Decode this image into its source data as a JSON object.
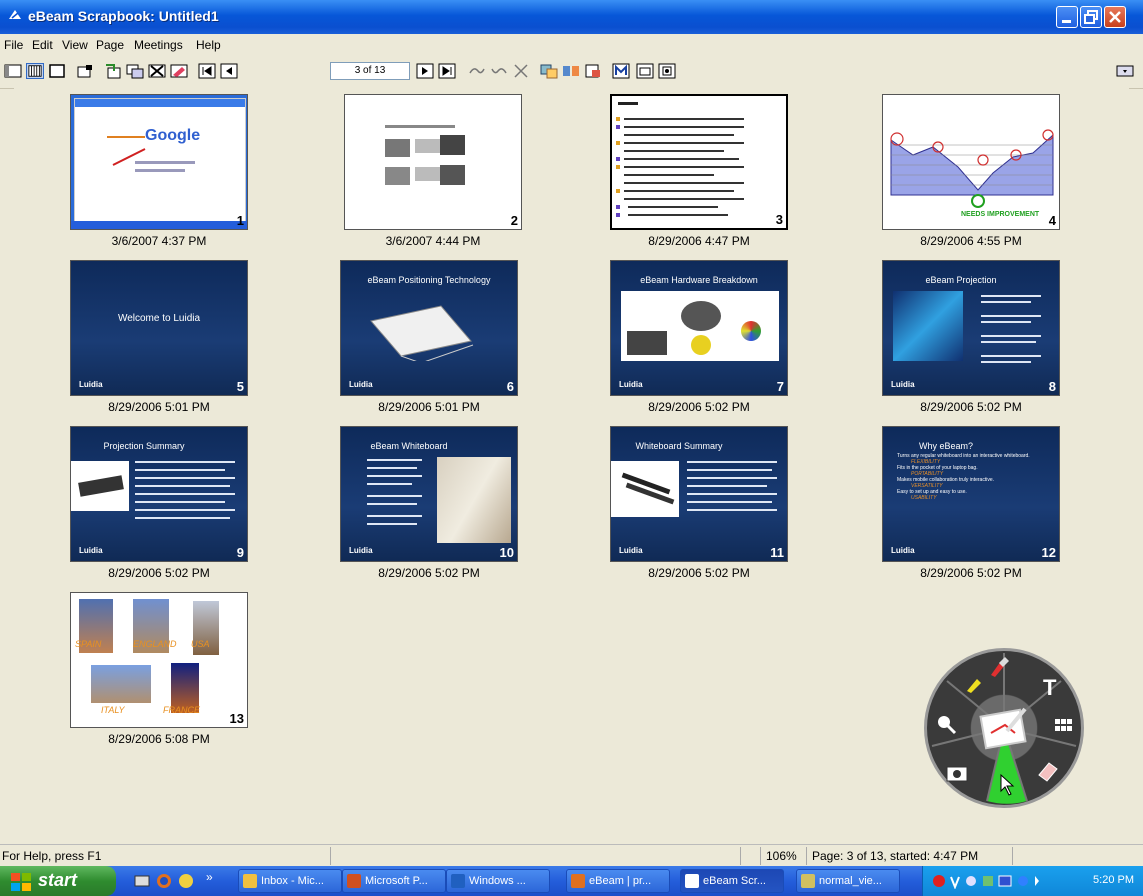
{
  "window": {
    "title": "eBeam Scrapbook: Untitled1"
  },
  "menu": [
    "File",
    "Edit",
    "View",
    "Page",
    "Meetings",
    "Help"
  ],
  "toolbar": {
    "page_indicator": "3 of 13"
  },
  "thumbnails": [
    {
      "num": "1",
      "caption": "3/6/2007 4:37 PM",
      "kind": "screenshot",
      "text": "Google"
    },
    {
      "num": "2",
      "caption": "3/6/2007 4:44 PM",
      "kind": "white"
    },
    {
      "num": "3",
      "caption": "8/29/2006 4:47 PM",
      "kind": "list",
      "selected": true
    },
    {
      "num": "4",
      "caption": "8/29/2006 4:55 PM",
      "kind": "chart"
    },
    {
      "num": "5",
      "caption": "8/29/2006 5:01 PM",
      "kind": "dark",
      "title": "Welcome to Luidia"
    },
    {
      "num": "6",
      "caption": "8/29/2006 5:01 PM",
      "kind": "dark",
      "title": "eBeam Positioning Technology"
    },
    {
      "num": "7",
      "caption": "8/29/2006 5:02 PM",
      "kind": "dark",
      "title": "eBeam Hardware Breakdown"
    },
    {
      "num": "8",
      "caption": "8/29/2006 5:02 PM",
      "kind": "dark",
      "title": "eBeam Projection"
    },
    {
      "num": "9",
      "caption": "8/29/2006 5:02 PM",
      "kind": "dark",
      "title": "Projection Summary"
    },
    {
      "num": "10",
      "caption": "8/29/2006 5:02 PM",
      "kind": "dark",
      "title": "eBeam Whiteboard"
    },
    {
      "num": "11",
      "caption": "8/29/2006 5:02 PM",
      "kind": "dark",
      "title": "Whiteboard Summary"
    },
    {
      "num": "12",
      "caption": "8/29/2006 5:02 PM",
      "kind": "dark",
      "title": "Why eBeam?"
    },
    {
      "num": "13",
      "caption": "8/29/2006 5:08 PM",
      "kind": "photos"
    }
  ],
  "slide12": {
    "bullets": [
      "Turns any regular whiteboard into an interactive whiteboard.",
      "Fits in the pocket of your laptop bag.",
      "Makes mobile collaboration truly interactive.",
      "Easy to set up and easy to use."
    ],
    "notes": [
      "FLEXIBILITY",
      "PORTABILITY",
      "VERSATILITY",
      "USABILITY"
    ]
  },
  "slide4": {
    "annotation": "NEEDS IMPROVEMENT"
  },
  "slide13": {
    "labels": [
      "SPAIN",
      "ENGLAND",
      "USA",
      "ITALY",
      "FRANCE"
    ]
  },
  "palette": {
    "text_tool": "T"
  },
  "status": {
    "help": "For Help, press F1",
    "zoom": "106%",
    "page_info": "Page: 3 of 13, started: 4:47 PM"
  },
  "taskbar": {
    "start": "start",
    "tasks": [
      {
        "label": "Inbox - Mic...",
        "color": "#f0c040"
      },
      {
        "label": "Microsoft P...",
        "color": "#d05020"
      },
      {
        "label": "Windows ...",
        "color": "#2060c0"
      },
      {
        "label": "eBeam | pr...",
        "color": "#e07020"
      },
      {
        "label": "eBeam Scr...",
        "color": "#ffffff",
        "active": true
      },
      {
        "label": "normal_vie...",
        "color": "#d0c060"
      }
    ],
    "clock": "5:20 PM"
  }
}
